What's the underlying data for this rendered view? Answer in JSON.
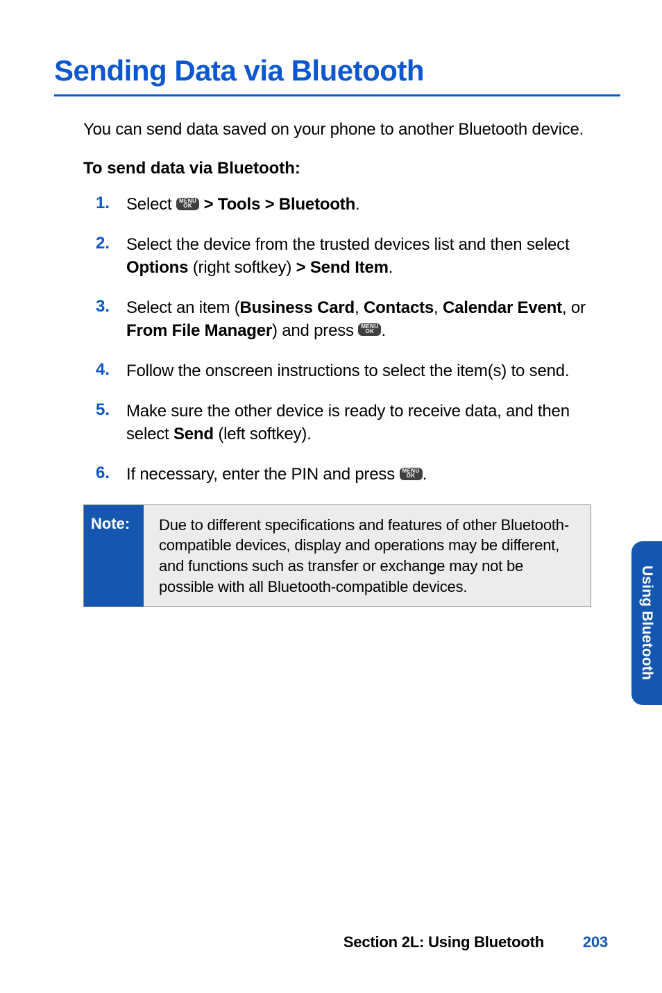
{
  "title": "Sending Data via Bluetooth",
  "intro": "You can send data saved on your phone to another Bluetooth device.",
  "subhead": "To send data via Bluetooth:",
  "menu_key": {
    "top": "MENU",
    "bottom": "OK"
  },
  "steps": [
    {
      "num": "1.",
      "pre": "Select ",
      "mid_bold": " > Tools > Bluetooth",
      "post": "."
    },
    {
      "num": "2.",
      "pre": "Select the device from the trusted devices list and then select ",
      "b1": "Options",
      "mid": " (right softkey) ",
      "b2": "> Send Item",
      "post": "."
    },
    {
      "num": "3.",
      "pre": "Select an item (",
      "b1": "Business Card",
      "s1": ", ",
      "b2": "Contacts",
      "s2": ", ",
      "b3": "Calendar Event",
      "s3": ", or ",
      "b4": "From File Manager",
      "mid": ") and press ",
      "post": "."
    },
    {
      "num": "4.",
      "text": "Follow the onscreen instructions to select the item(s) to send."
    },
    {
      "num": "5.",
      "pre": "Make sure the other device is ready to receive data, and then select ",
      "b1": "Send",
      "post": " (left softkey)."
    },
    {
      "num": "6.",
      "pre": "If necessary, enter the PIN and press ",
      "post": "."
    }
  ],
  "note": {
    "label": "Note:",
    "text": "Due to different specifications and features of other Bluetooth-compatible devices, display and operations may be different, and functions such as transfer or exchange may not be possible with all Bluetooth-compatible devices."
  },
  "side_tab": "Using Bluetooth",
  "footer": {
    "section": "Section 2L: Using Bluetooth",
    "page": "203"
  }
}
